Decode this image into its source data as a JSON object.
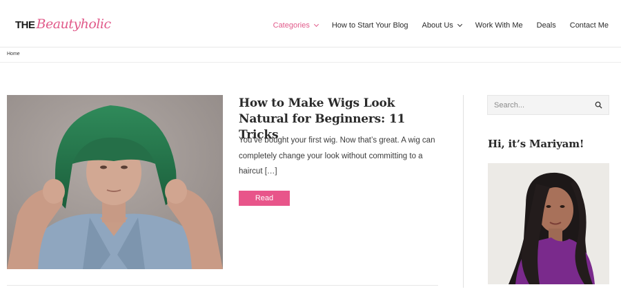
{
  "logo": {
    "prefix": "THE",
    "script": "Beautyholic"
  },
  "nav": {
    "items": [
      {
        "label": "Categories",
        "dropdown": true,
        "active": true
      },
      {
        "label": "How to Start Your Blog",
        "dropdown": false,
        "active": false
      },
      {
        "label": "About Us",
        "dropdown": true,
        "active": false
      },
      {
        "label": "Work With Me",
        "dropdown": false,
        "active": false
      },
      {
        "label": "Deals",
        "dropdown": false,
        "active": false
      },
      {
        "label": "Contact Me",
        "dropdown": false,
        "active": false
      }
    ]
  },
  "breadcrumb": {
    "home": "Home"
  },
  "post": {
    "title": "How to Make Wigs Look Natural for Beginners: 11 Tricks",
    "excerpt": "You’ve bought your first wig.  Now that’s great. A wig can completely change your look without committing to a haircut […]",
    "read_label": "Read",
    "image_icon": "woman-green-wig-photo"
  },
  "sidebar": {
    "search_placeholder": "Search...",
    "search_icon": "search-icon",
    "widget_title": "Hi, it’s Mariyam!",
    "author_photo_icon": "author-portrait-photo"
  },
  "colors": {
    "accent": "#e15a8a",
    "button": "#e8558a",
    "text": "#2a2a2a",
    "border": "#e8e8e8"
  }
}
